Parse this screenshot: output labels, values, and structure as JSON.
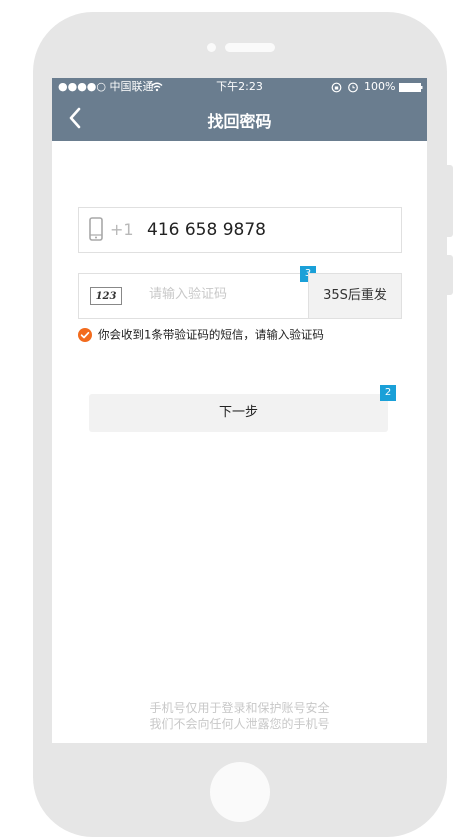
{
  "status_bar": {
    "carrier": "●●●●○ 中国联通",
    "time": "下午2:23",
    "battery": "100%",
    "icons": [
      "wifi-icon",
      "lock-rotation-icon",
      "alarm-icon",
      "battery-icon"
    ]
  },
  "nav": {
    "title": "找回密码",
    "back_icon": "chevron-left-icon"
  },
  "phone_field": {
    "icon": "mobile-phone-icon",
    "country_code": "+1",
    "value": "416 658 9878"
  },
  "code_field": {
    "icon": "captcha-123-icon",
    "icon_text": "123",
    "placeholder": "请输入验证码",
    "value": "",
    "badge": "3"
  },
  "resend_button": {
    "label": "35S后重发"
  },
  "notice": {
    "icon": "check-circle-icon",
    "text": "你会收到1条带验证码的短信，请输入验证码"
  },
  "next_button": {
    "label": "下一步",
    "badge": "2"
  },
  "footer": {
    "line1": "手机号仅用于登录和保护账号安全",
    "line2": "我们不会向任何人泄露您的手机号"
  },
  "colors": {
    "header": "#6a7d8f",
    "badge": "#1aa0d8",
    "check": "#f26b1d",
    "device": "#e6e6e6"
  }
}
